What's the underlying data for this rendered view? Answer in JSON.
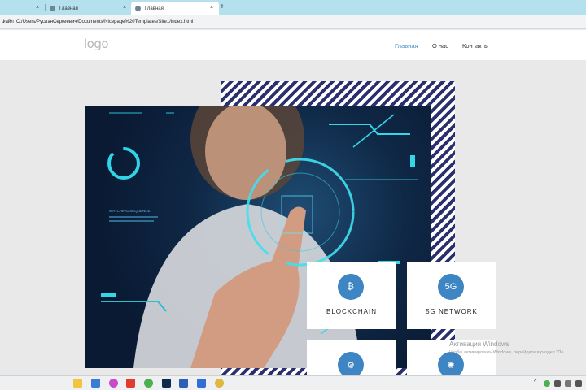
{
  "browser": {
    "tabs": [
      {
        "label": ""
      },
      {
        "label": "Главная"
      },
      {
        "label": "Главная"
      }
    ],
    "new_tab_symbol": "+",
    "close_symbol": "×",
    "address_label": "Файл",
    "address_url": "C:/Users/РусланСергеевич/Documents/Nicepage%20Templates/Site1/index.html"
  },
  "site": {
    "logo": "logo",
    "nav": [
      {
        "label": "Главная",
        "active": true
      },
      {
        "label": "О нас"
      },
      {
        "label": "Контакты"
      }
    ],
    "hero_caption": {
      "title": "WATCHING SEQUENCE"
    },
    "cards": [
      {
        "label": "BLOCKCHAIN",
        "icon": "bitcoin-icon",
        "glyph": "₿"
      },
      {
        "label": "5G NETWORK",
        "icon": "5g-signal-icon",
        "glyph": "5G"
      },
      {
        "label": "",
        "icon": "ai-head-icon",
        "glyph": "⚙"
      },
      {
        "label": "",
        "icon": "brain-chip-icon",
        "glyph": "✺"
      }
    ],
    "accent_color": "#3d86c3",
    "stripe_color": "#2a2f6e"
  },
  "watermark": {
    "title": "Активация Windows",
    "subtitle": "Чтобы активировать Windows, перейдите в раздел \"Па"
  },
  "taskbar": {
    "icons": [
      "file-explorer-icon",
      "store-icon",
      "mail-icon",
      "yandex-icon",
      "chrome-icon",
      "photoshop-icon",
      "word-icon",
      "nicepage-icon",
      "chrome-active-icon"
    ],
    "tray_chevron": "^"
  }
}
